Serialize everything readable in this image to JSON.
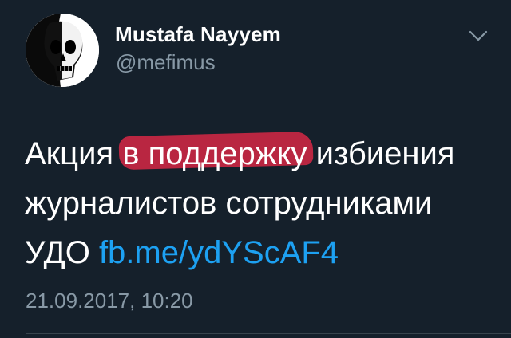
{
  "user": {
    "display_name": "Mustafa Nayyem",
    "handle": "@mefimus",
    "avatar_icon": "skull-avatar-icon"
  },
  "menu": {
    "caret_icon": "chevron-down-icon"
  },
  "tweet": {
    "line1_before": "Акция ",
    "line1_highlight_a": "в",
    "line1_highlight_b": " поддержку",
    "line1_after": " избиения",
    "line2": "журналистов сотрудниками",
    "line3_text": "УДО ",
    "link_text": "fb.me/ydYScAF4",
    "highlight_color": "#e82848",
    "link_color": "#1da1f2"
  },
  "timestamp": "21.09.2017, 10:20",
  "colors": {
    "background": "#15202b",
    "secondary_text": "#8899a6",
    "divider": "#38444d"
  }
}
